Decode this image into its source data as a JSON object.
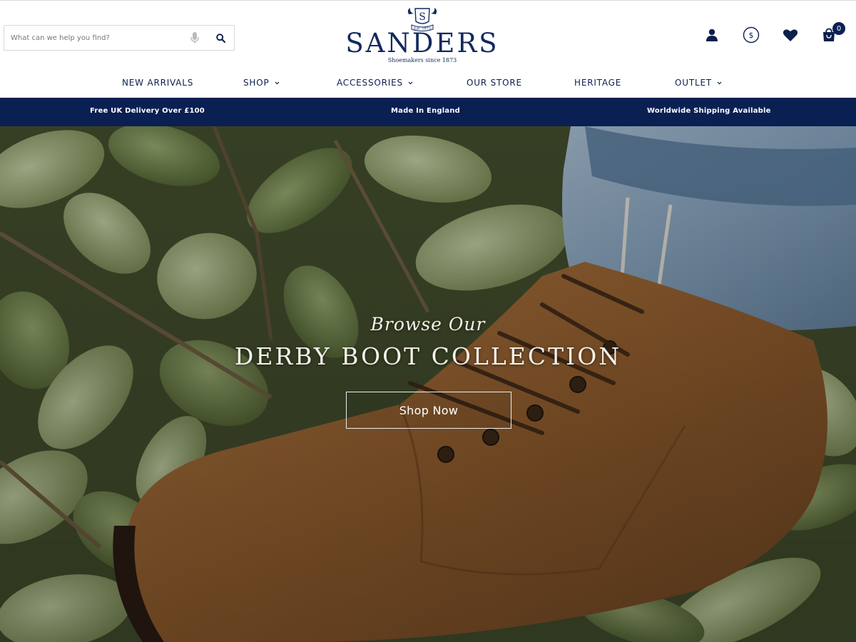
{
  "search": {
    "placeholder": "What can we help you find?"
  },
  "logo": {
    "name": "SANDERS",
    "tagline": "Shoemakers since 1873",
    "crest_letter": "S",
    "crest_banner": "Est. 1873"
  },
  "header_icons": [
    "account-icon",
    "currency-icon",
    "wishlist-icon",
    "cart-icon"
  ],
  "cart": {
    "count": "0"
  },
  "nav": {
    "items": [
      {
        "label": "NEW ARRIVALS"
      },
      {
        "label": "SHOP"
      },
      {
        "label": "ACCESSORIES"
      },
      {
        "label": "OUR STORE"
      },
      {
        "label": "HERITAGE"
      },
      {
        "label": "OUTLET"
      }
    ]
  },
  "infobar": {
    "items": [
      "Free UK Delivery Over £100",
      "Made In England",
      "Worldwide Shipping Available"
    ]
  },
  "hero": {
    "kicker": "Browse Our",
    "title": "DERBY BOOT COLLECTION",
    "button": "Shop Now"
  },
  "colors": {
    "navy": "#0a1f52",
    "logo_navy": "#132a5e",
    "white": "#ffffff"
  }
}
